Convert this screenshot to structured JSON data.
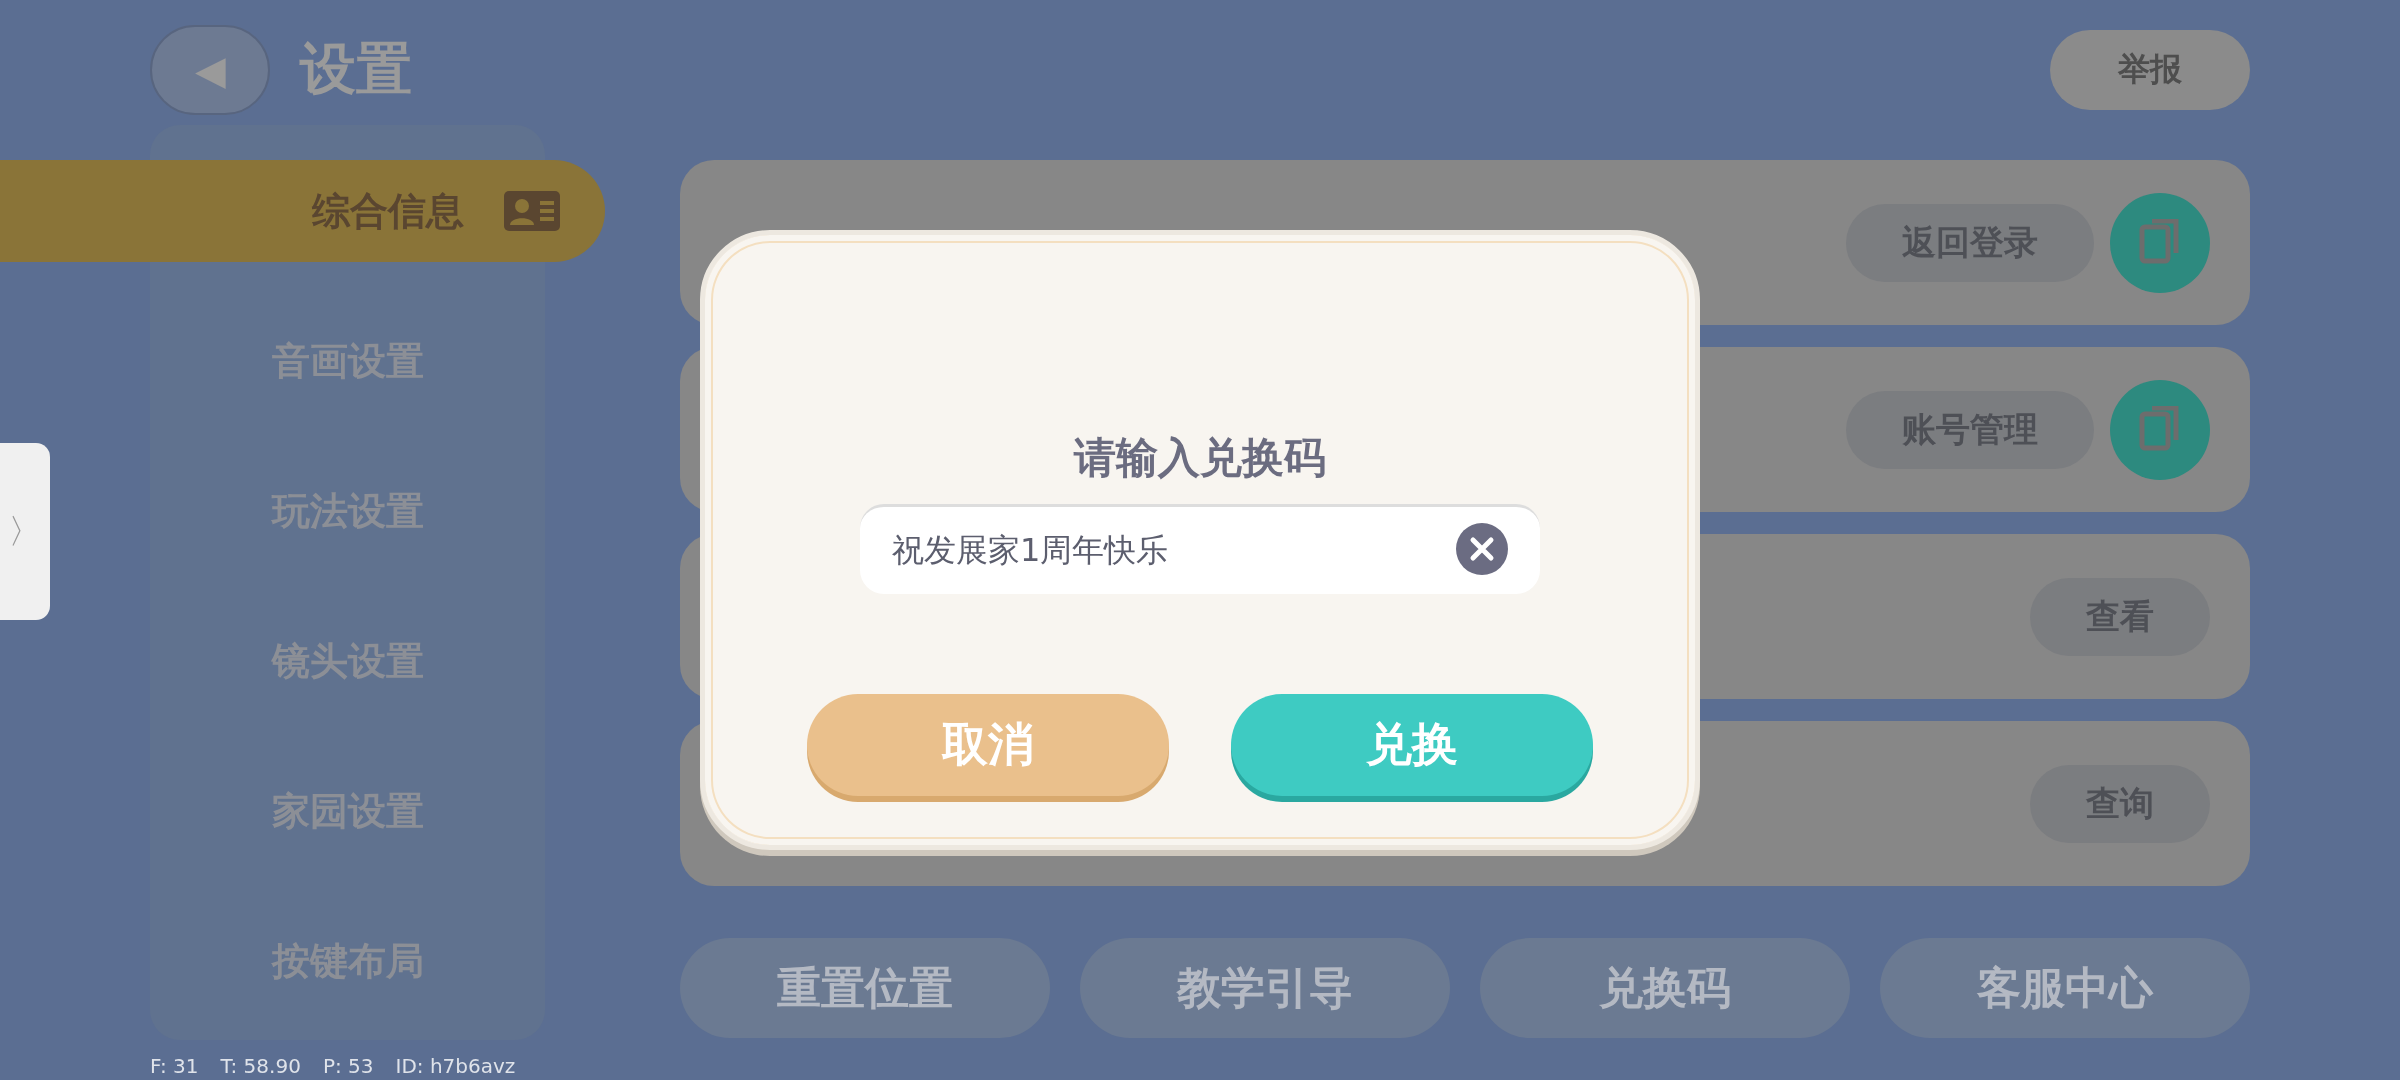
{
  "header": {
    "back_icon": "◀",
    "title": "设置",
    "report_button": "举报"
  },
  "sidebar": {
    "items": [
      {
        "label": "综合信息",
        "selected": true
      },
      {
        "label": "音画设置",
        "selected": false
      },
      {
        "label": "玩法设置",
        "selected": false
      },
      {
        "label": "镜头设置",
        "selected": false
      },
      {
        "label": "家园设置",
        "selected": false
      },
      {
        "label": "按键布局",
        "selected": false
      }
    ]
  },
  "side_handle": "〉",
  "cards": [
    {
      "button": "返回登录",
      "copy": true
    },
    {
      "button": "账号管理",
      "copy": true
    },
    {
      "button": "查看",
      "copy": false
    },
    {
      "button": "查询",
      "copy": false
    }
  ],
  "bottom_buttons": [
    "重置位置",
    "教学引导",
    "兑换码",
    "客服中心"
  ],
  "stats": [
    "F: 31",
    "T: 58.90",
    "P: 53",
    "ID: h7b6avz"
  ],
  "dialog": {
    "title": "请输入兑换码",
    "input_value": "祝发展家1周年快乐",
    "buttons": [
      {
        "label": "取消",
        "kind": "cancel"
      },
      {
        "label": "兑换",
        "kind": "confirm"
      }
    ]
  }
}
